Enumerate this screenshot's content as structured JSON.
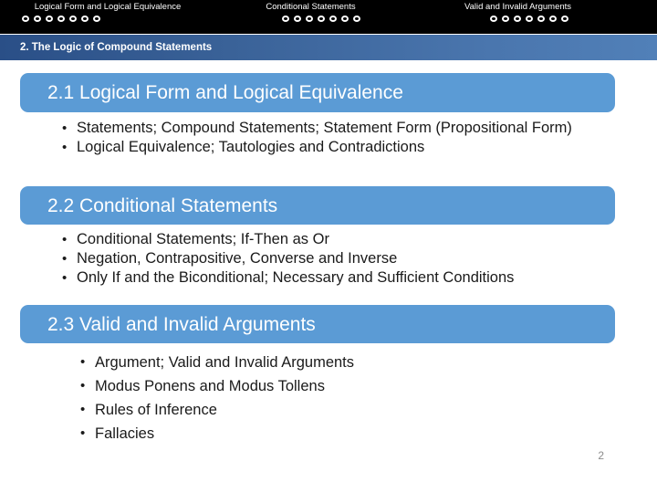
{
  "topbar": {
    "background_color": "#000000",
    "groups": [
      {
        "label": "Logical Form and Logical Equivalence",
        "dot_count": 7
      },
      {
        "label": "Conditional Statements",
        "dot_count": 7
      },
      {
        "label": "Valid and Invalid Arguments",
        "dot_count": 7
      }
    ]
  },
  "titlebar": {
    "text": "2. The Logic of Compound Statements",
    "gradient_from": "#2a4f87",
    "gradient_to": "#5180b8"
  },
  "sections": [
    {
      "heading": "2.1 Logical Form and Logical Equivalence",
      "accent_color": "#5b9bd5",
      "bullets": [
        "Statements; Compound Statements; Statement Form (Propositional Form)",
        "Logical Equivalence; Tautologies and Contradictions"
      ]
    },
    {
      "heading": "2.2 Conditional Statements",
      "accent_color": "#5b9bd5",
      "bullets": [
        "Conditional Statements; If-Then as Or",
        "Negation, Contrapositive, Converse and Inverse",
        "Only If and the Biconditional; Necessary and Sufficient Conditions"
      ]
    },
    {
      "heading": "2.3 Valid and Invalid Arguments",
      "accent_color": "#5b9bd5",
      "bullets": [
        "Argument; Valid and Invalid Arguments",
        "Modus Ponens and Modus Tollens",
        "Rules of Inference",
        "Fallacies"
      ]
    }
  ],
  "footer": {
    "page_number": "2"
  }
}
